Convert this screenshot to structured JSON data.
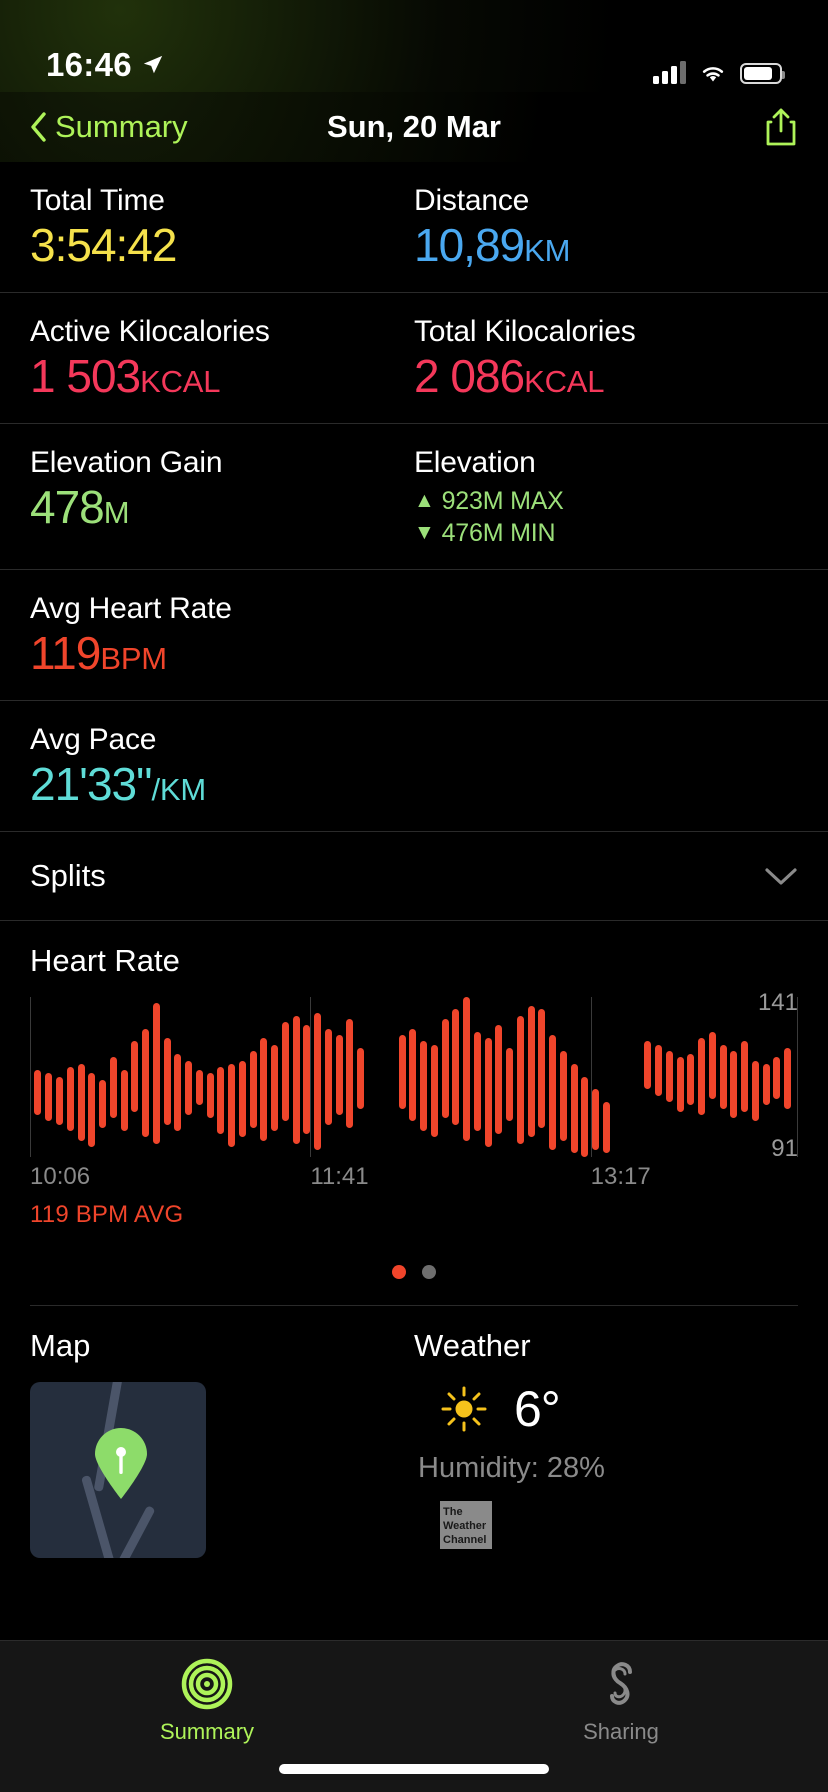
{
  "status_bar": {
    "time": "16:46",
    "location_icon": "location-arrow-icon",
    "cellular_icon": "cellular-bars-icon",
    "wifi_icon": "wifi-icon",
    "battery_icon": "battery-icon"
  },
  "nav": {
    "back_label": "Summary",
    "back_icon": "chevron-left-icon",
    "title": "Sun, 20 Mar",
    "share_icon": "share-icon"
  },
  "metrics": [
    {
      "label": "Total Time",
      "value": "3:54:42",
      "unit": "",
      "color": "#f5e14b"
    },
    {
      "label": "Distance",
      "value": "10,89",
      "unit": "KM",
      "color": "#4aa8f0"
    },
    {
      "label": "Active Kilocalories",
      "value": "1 503",
      "unit": "KCAL",
      "color": "#f4385a"
    },
    {
      "label": "Total Kilocalories",
      "value": "2 086",
      "unit": "KCAL",
      "color": "#f4385a"
    },
    {
      "label": "Elevation Gain",
      "value": "478",
      "unit": "M",
      "color": "#9ce07a"
    },
    {
      "label": "Avg Heart Rate",
      "value": "119",
      "unit": "BPM",
      "color": "#f0452b"
    },
    {
      "label": "Avg Pace",
      "value": "21'33\"",
      "unit": "/KM",
      "color": "#5fdcd7"
    }
  ],
  "elevation": {
    "label": "Elevation",
    "max_arrow": "▲",
    "max": "923M MAX",
    "min_arrow": "▼",
    "min": "476M MIN",
    "color": "#9ce07a"
  },
  "splits": {
    "label": "Splits",
    "expand_icon": "chevron-down-icon"
  },
  "heart_rate": {
    "title": "Heart Rate",
    "avg_legend": "119 BPM AVG",
    "accent": "#f0452b"
  },
  "chart_data": {
    "type": "bar",
    "title": "Heart Rate",
    "xlabel": "",
    "ylabel": "BPM",
    "ylim": [
      91,
      141
    ],
    "y_max_label": "141",
    "y_min_label": "91",
    "tick_labels": [
      "10:06",
      "11:41",
      "13:17"
    ],
    "tick_positions_pct": [
      0,
      36.5,
      73
    ],
    "grid": false,
    "legend": "119 BPM AVG",
    "avg": 119,
    "unit": "BPM",
    "series": [
      {
        "name": "Heart Rate Range",
        "bars": [
          {
            "x": 0.5,
            "low": 104,
            "high": 118
          },
          {
            "x": 2.0,
            "low": 102,
            "high": 117
          },
          {
            "x": 3.4,
            "low": 101,
            "high": 116
          },
          {
            "x": 4.8,
            "low": 99,
            "high": 119
          },
          {
            "x": 6.2,
            "low": 96,
            "high": 120
          },
          {
            "x": 7.6,
            "low": 94,
            "high": 117
          },
          {
            "x": 9.0,
            "low": 100,
            "high": 115
          },
          {
            "x": 10.4,
            "low": 103,
            "high": 122
          },
          {
            "x": 11.8,
            "low": 99,
            "high": 118
          },
          {
            "x": 13.2,
            "low": 105,
            "high": 127
          },
          {
            "x": 14.6,
            "low": 97,
            "high": 131
          },
          {
            "x": 16.0,
            "low": 95,
            "high": 139
          },
          {
            "x": 17.4,
            "low": 101,
            "high": 128
          },
          {
            "x": 18.8,
            "low": 99,
            "high": 123
          },
          {
            "x": 20.2,
            "low": 104,
            "high": 121
          },
          {
            "x": 21.6,
            "low": 107,
            "high": 118
          },
          {
            "x": 23.0,
            "low": 103,
            "high": 117
          },
          {
            "x": 24.4,
            "low": 98,
            "high": 119
          },
          {
            "x": 25.8,
            "low": 94,
            "high": 120
          },
          {
            "x": 27.2,
            "low": 97,
            "high": 121
          },
          {
            "x": 28.6,
            "low": 100,
            "high": 124
          },
          {
            "x": 30.0,
            "low": 96,
            "high": 128
          },
          {
            "x": 31.4,
            "low": 99,
            "high": 126
          },
          {
            "x": 32.8,
            "low": 102,
            "high": 133
          },
          {
            "x": 34.2,
            "low": 95,
            "high": 135
          },
          {
            "x": 35.6,
            "low": 98,
            "high": 132
          },
          {
            "x": 37.0,
            "low": 93,
            "high": 136
          },
          {
            "x": 38.4,
            "low": 101,
            "high": 131
          },
          {
            "x": 39.8,
            "low": 104,
            "high": 129
          },
          {
            "x": 41.2,
            "low": 100,
            "high": 134
          },
          {
            "x": 42.6,
            "low": 106,
            "high": 125
          },
          {
            "x": 48.0,
            "low": 106,
            "high": 129
          },
          {
            "x": 49.4,
            "low": 102,
            "high": 131
          },
          {
            "x": 50.8,
            "low": 99,
            "high": 127
          },
          {
            "x": 52.2,
            "low": 97,
            "high": 126
          },
          {
            "x": 53.6,
            "low": 103,
            "high": 134
          },
          {
            "x": 55.0,
            "low": 101,
            "high": 137
          },
          {
            "x": 56.4,
            "low": 96,
            "high": 141
          },
          {
            "x": 57.8,
            "low": 99,
            "high": 130
          },
          {
            "x": 59.2,
            "low": 94,
            "high": 128
          },
          {
            "x": 60.6,
            "low": 98,
            "high": 132
          },
          {
            "x": 62.0,
            "low": 102,
            "high": 125
          },
          {
            "x": 63.4,
            "low": 95,
            "high": 135
          },
          {
            "x": 64.8,
            "low": 97,
            "high": 138
          },
          {
            "x": 66.2,
            "low": 100,
            "high": 137
          },
          {
            "x": 67.6,
            "low": 93,
            "high": 129
          },
          {
            "x": 69.0,
            "low": 96,
            "high": 124
          },
          {
            "x": 70.4,
            "low": 92,
            "high": 120
          },
          {
            "x": 71.8,
            "low": 91,
            "high": 116
          },
          {
            "x": 73.2,
            "low": 93,
            "high": 112
          },
          {
            "x": 74.6,
            "low": 92,
            "high": 108
          },
          {
            "x": 80.0,
            "low": 112,
            "high": 127
          },
          {
            "x": 81.4,
            "low": 110,
            "high": 126
          },
          {
            "x": 82.8,
            "low": 108,
            "high": 124
          },
          {
            "x": 84.2,
            "low": 105,
            "high": 122
          },
          {
            "x": 85.6,
            "low": 107,
            "high": 123
          },
          {
            "x": 87.0,
            "low": 104,
            "high": 128
          },
          {
            "x": 88.4,
            "low": 109,
            "high": 130
          },
          {
            "x": 89.8,
            "low": 106,
            "high": 126
          },
          {
            "x": 91.2,
            "low": 103,
            "high": 124
          },
          {
            "x": 92.6,
            "low": 105,
            "high": 127
          },
          {
            "x": 94.0,
            "low": 102,
            "high": 121
          },
          {
            "x": 95.4,
            "low": 107,
            "high": 120
          },
          {
            "x": 96.8,
            "low": 109,
            "high": 122
          },
          {
            "x": 98.2,
            "low": 106,
            "high": 125
          }
        ]
      }
    ],
    "pagination": {
      "total": 2,
      "active": 1
    }
  },
  "map": {
    "title": "Map",
    "pin_icon": "map-pin-icon"
  },
  "weather": {
    "title": "Weather",
    "condition_icon": "sun-icon",
    "temperature": "6°",
    "humidity": "Humidity: 28%",
    "attribution": "The Weather Channel"
  },
  "tabbar": {
    "tabs": [
      {
        "label": "Summary",
        "icon": "activity-rings-icon",
        "active": true
      },
      {
        "label": "Sharing",
        "icon": "sharing-icon",
        "active": false
      }
    ]
  }
}
